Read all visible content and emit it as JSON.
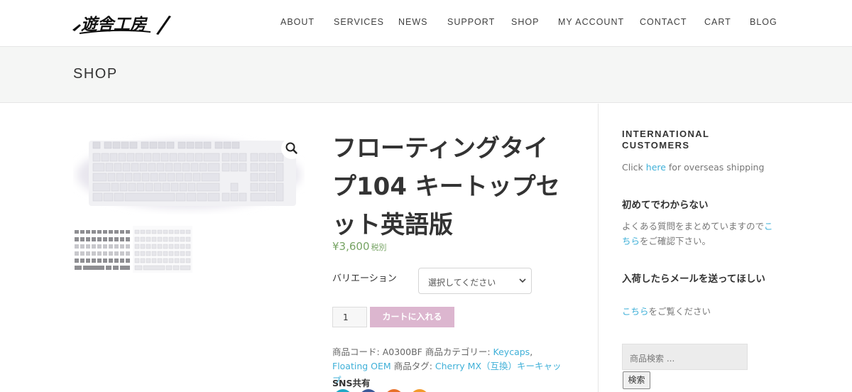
{
  "header": {
    "logo_text": "遊舎工房",
    "nav": [
      {
        "label": "ABOUT",
        "key": "about"
      },
      {
        "label": "SERVICES",
        "key": "services"
      },
      {
        "label": "NEWS",
        "key": "news"
      },
      {
        "label": "SUPPORT",
        "key": "support"
      },
      {
        "label": "SHOP",
        "key": "shop"
      },
      {
        "label": "MY ACCOUNT",
        "key": "my-account"
      },
      {
        "label": "CONTACT",
        "key": "contact"
      },
      {
        "label": "CART",
        "key": "cart"
      },
      {
        "label": "BLOG",
        "key": "blog"
      }
    ]
  },
  "page": {
    "title": "SHOP"
  },
  "product": {
    "title": "フローティングタイプ104 キートップセット英語版",
    "price": "¥3,600",
    "tax_label": "税別",
    "variation_label": "バリエーション",
    "variation_value": "選択してください",
    "quantity": "1",
    "add_to_cart_label": "カートに入れる",
    "sku_label": "商品コード:",
    "sku": "A0300BF",
    "category_label": "商品カテゴリー:",
    "category_1": "Keycaps",
    "category_sep": ",",
    "category_2": "Floating OEM",
    "tag_label": "商品タグ:",
    "tag_1": "Cherry MX（互換）キーキャップ",
    "share_label": "SNS共有"
  },
  "icons": {
    "zoom": "magnifier-icon",
    "select_chevron": "chevron-down-icon"
  },
  "sidebar": {
    "widget1": {
      "title": "INTERNATIONAL CUSTOMERS",
      "text_before": "Click ",
      "link": "here",
      "text_after": " for overseas shipping"
    },
    "widget2": {
      "title": "初めてでわからない",
      "text_before": "よくある質問をまとめていますので",
      "link": "こちら",
      "text_after": "をご確認下さい。"
    },
    "widget3": {
      "title": "入荷したらメールを送ってほしい",
      "link": "こちら",
      "text_after": "をご覧ください"
    },
    "search": {
      "placeholder": "商品検索 ...",
      "button": "検索"
    }
  },
  "colors": {
    "price": "#77a464",
    "link": "#3fb0d8",
    "cart_button": "#dcb6cf",
    "title_band": "#f5f6f5",
    "share_circles": [
      "#20a8c6",
      "#3b5998",
      "#e8702a",
      "#f39a2b"
    ]
  }
}
